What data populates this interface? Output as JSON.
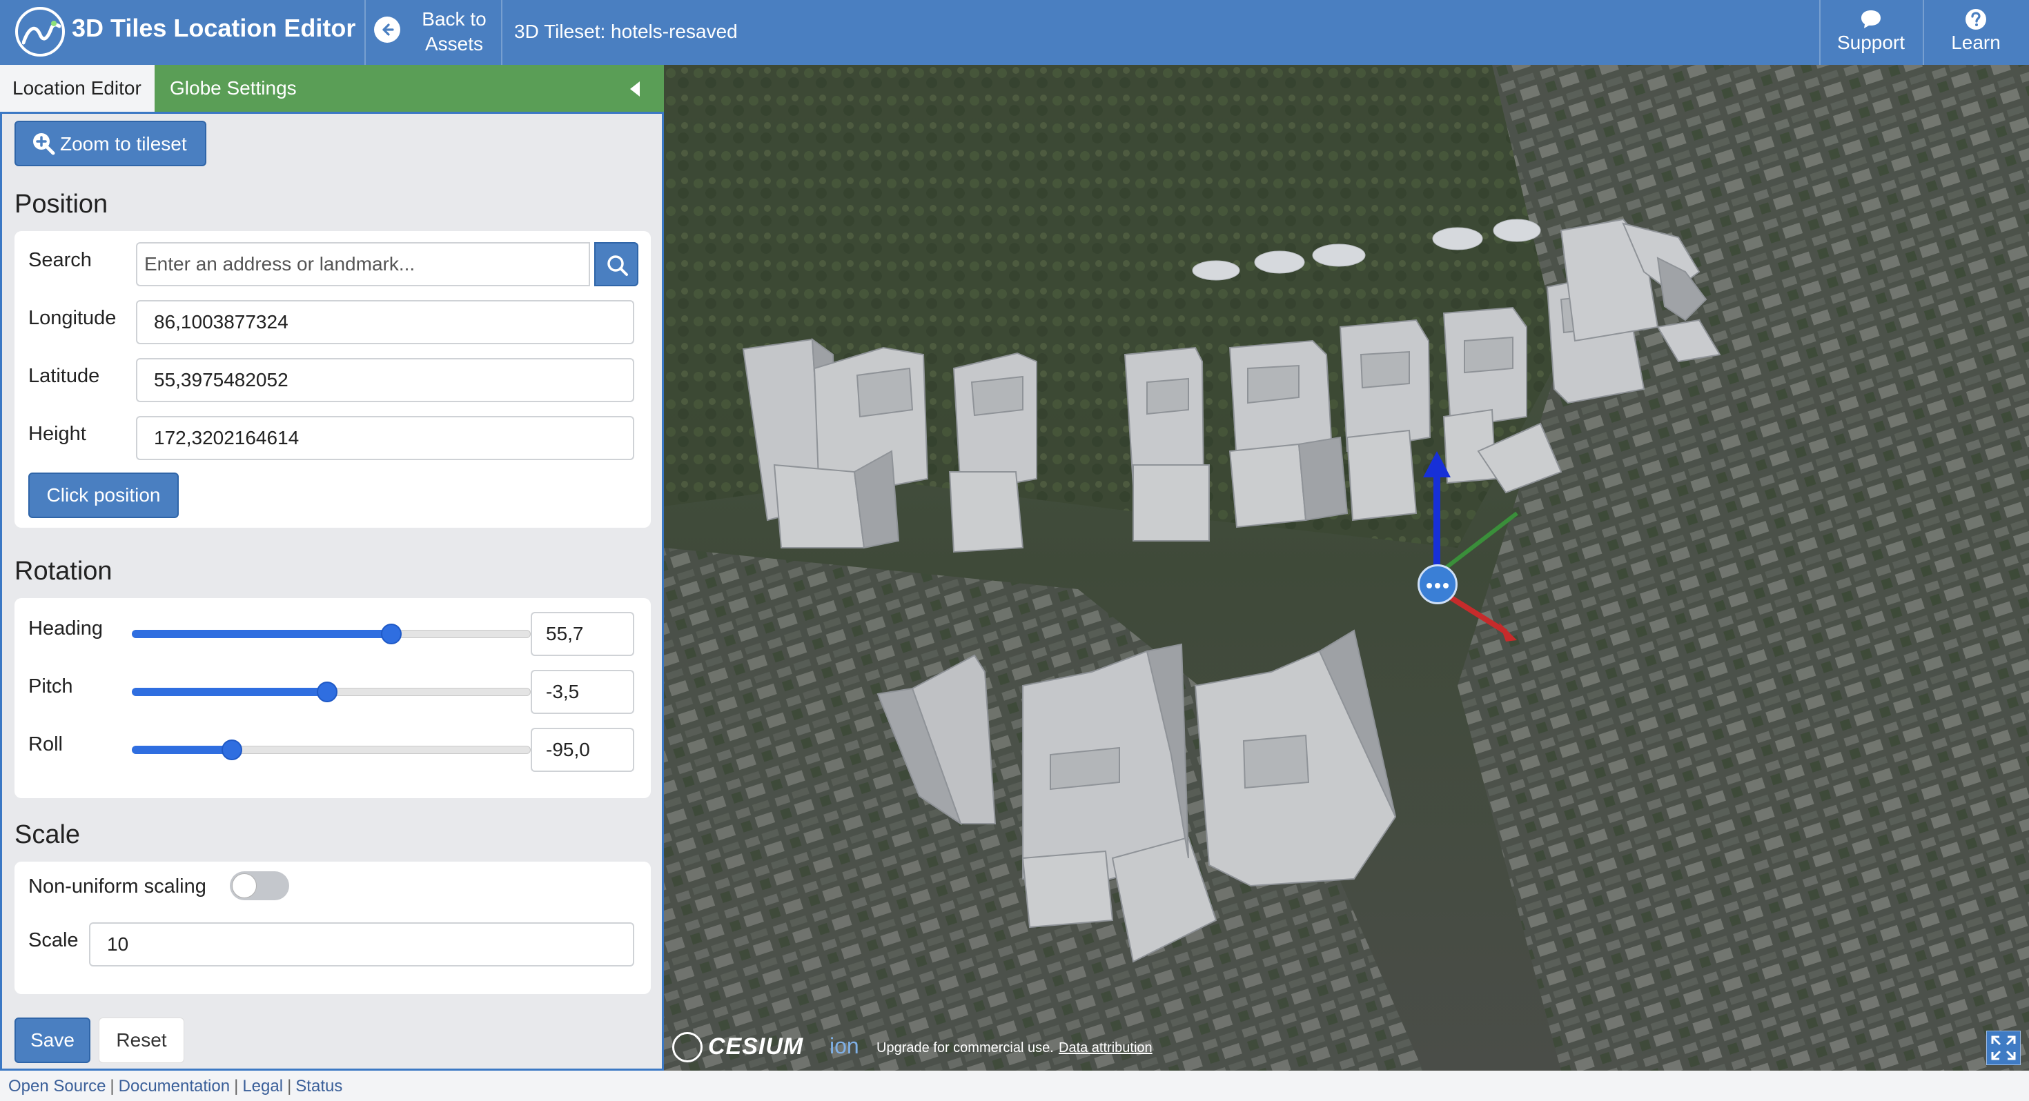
{
  "header": {
    "app_title": "3D Tiles Location Editor",
    "back_label_line1": "Back to",
    "back_label_line2": "Assets",
    "tileset_label": "3D Tileset: hotels-resaved",
    "support_label": "Support",
    "learn_label": "Learn",
    "brand_color": "#4a7fc1"
  },
  "tabs": [
    {
      "label": "Location Editor",
      "active": true
    },
    {
      "label": "Globe Settings",
      "active": false
    }
  ],
  "zoom_button_label": "Zoom to tileset",
  "position": {
    "title": "Position",
    "search_label": "Search",
    "search_placeholder": "Enter an address or landmark...",
    "search_value": "",
    "longitude_label": "Longitude",
    "longitude_value": "86,1003877324",
    "latitude_label": "Latitude",
    "latitude_value": "55,3975482052",
    "height_label": "Height",
    "height_value": "172,3202164614",
    "click_position_label": "Click position"
  },
  "rotation": {
    "title": "Rotation",
    "heading_label": "Heading",
    "heading_value": "55,7",
    "heading_slider_fraction": 0.65,
    "pitch_label": "Pitch",
    "pitch_value": "-3,5",
    "pitch_slider_fraction": 0.49,
    "roll_label": "Roll",
    "roll_value": "-95,0",
    "roll_slider_fraction": 0.25
  },
  "scale": {
    "title": "Scale",
    "nonuniform_label": "Non-uniform scaling",
    "nonuniform_enabled": false,
    "scale_label": "Scale",
    "scale_value": "10"
  },
  "actions": {
    "save_label": "Save",
    "reset_label": "Reset"
  },
  "footer": {
    "links": [
      "Open Source",
      "Documentation",
      "Legal",
      "Status"
    ]
  },
  "viewer": {
    "cesium_text": "CESIUM",
    "ion_text": "ion",
    "upgrade_text": "Upgrade for commercial use.",
    "attribution_link": "Data attribution"
  }
}
